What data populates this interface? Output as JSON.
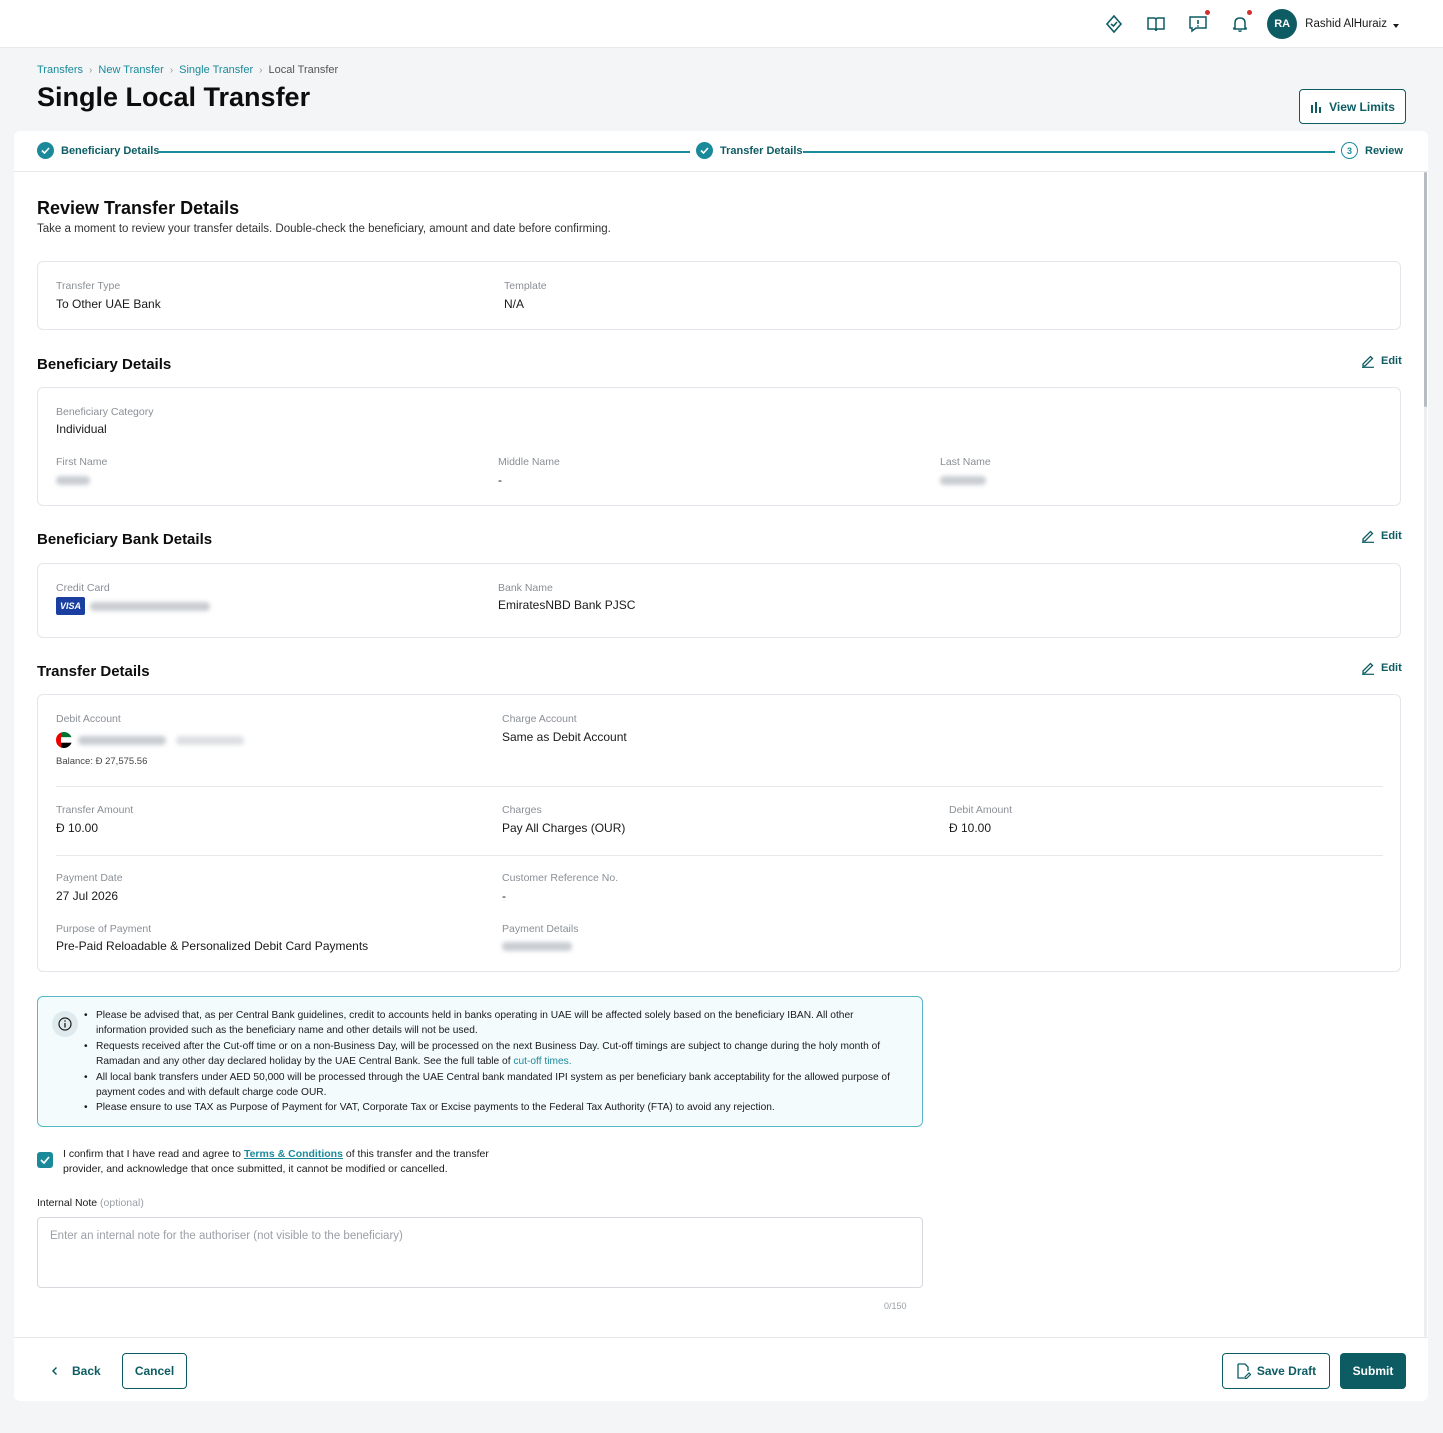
{
  "header": {
    "user_initials": "RA",
    "user_name": "Rashid AlHuraiz"
  },
  "breadcrumb": [
    "Transfers",
    "New Transfer",
    "Single Transfer",
    "Local Transfer"
  ],
  "page_title": "Single Local Transfer",
  "view_limits_label": "View Limits",
  "stepper": {
    "steps": [
      {
        "label": "Beneficiary Details",
        "state": "done"
      },
      {
        "label": "Transfer Details",
        "state": "done"
      },
      {
        "label": "Review",
        "number": "3",
        "state": "current"
      }
    ]
  },
  "review": {
    "title": "Review Transfer Details",
    "subtitle": "Take a moment to review your transfer details. Double-check the beneficiary, amount and date before confirming.",
    "transfer_type_label": "Transfer Type",
    "transfer_type_value": "To Other UAE Bank",
    "template_label": "Template",
    "template_value": "N/A"
  },
  "edit_label": "Edit",
  "beneficiary": {
    "title": "Beneficiary Details",
    "category_label": "Beneficiary Category",
    "category_value": "Individual",
    "first_name_label": "First Name",
    "middle_name_label": "Middle Name",
    "middle_name_value": "-",
    "last_name_label": "Last Name"
  },
  "bank": {
    "title": "Beneficiary Bank Details",
    "card_label": "Credit Card",
    "card_brand": "VISA",
    "bank_name_label": "Bank Name",
    "bank_name_value": "EmiratesNBD Bank PJSC"
  },
  "transfer": {
    "title": "Transfer Details",
    "debit_account_label": "Debit Account",
    "balance_text": "Balance: Đ 27,575.56",
    "charge_account_label": "Charge Account",
    "charge_account_value": "Same as Debit Account",
    "transfer_amount_label": "Transfer Amount",
    "transfer_amount_value": "Đ 10.00",
    "charges_label": "Charges",
    "charges_value": "Pay All Charges (OUR)",
    "debit_amount_label": "Debit Amount",
    "debit_amount_value": "Đ 10.00",
    "payment_date_label": "Payment Date",
    "payment_date_value": "27 Jul 2026",
    "customer_ref_label": "Customer Reference No.",
    "customer_ref_value": "-",
    "purpose_label": "Purpose of Payment",
    "purpose_value": "Pre-Paid Reloadable & Personalized Debit Card Payments",
    "payment_details_label": "Payment Details"
  },
  "info_notes": {
    "note1": "Please be advised that, as per Central Bank guidelines, credit to accounts held in banks operating in UAE will be affected solely based on the beneficiary IBAN. All other information provided such as the beneficiary name and other details will not be used.",
    "note2": "Requests received after the Cut-off time or on a non-Business Day, will be processed on the next Business Day. Cut-off timings are subject to change during the holy month of Ramadan and any other day declared holiday by the UAE Central Bank. See the full table of",
    "note2_link": "cut-off times.",
    "note3": "All local bank transfers under AED 50,000 will be processed through the UAE Central bank mandated IPI system as per beneficiary bank acceptability for the allowed purpose of payment codes and with default charge code OUR.",
    "note4": "Please ensure to use TAX as Purpose of Payment for VAT, Corporate Tax or Excise payments to the Federal Tax Authority (FTA) to avoid any rejection."
  },
  "confirm": {
    "before": "I confirm that I have read and agree to",
    "link": "Terms & Conditions",
    "after": "of this transfer and the transfer provider, and acknowledge that once submitted, it cannot be modified or cancelled."
  },
  "internal_note": {
    "label": "Internal Note",
    "optional": "(optional)",
    "placeholder": "Enter an internal note for the authoriser (not visible to the beneficiary)",
    "counter": "0/150"
  },
  "footer": {
    "back": "Back",
    "cancel": "Cancel",
    "save_draft": "Save Draft",
    "submit": "Submit"
  },
  "colors": {
    "primary": "#0d5c63",
    "accent": "#1a8a9a",
    "info_border": "#5ab7c7",
    "notification_dot": "#d32f2f"
  },
  "icons": [
    "support-icon",
    "book-icon",
    "feedback-icon",
    "bell-icon",
    "check-icon",
    "edit-icon",
    "info-icon",
    "chart-icon",
    "chevron-left-icon",
    "save-draft-icon",
    "uae-flag-icon",
    "visa-icon"
  ]
}
